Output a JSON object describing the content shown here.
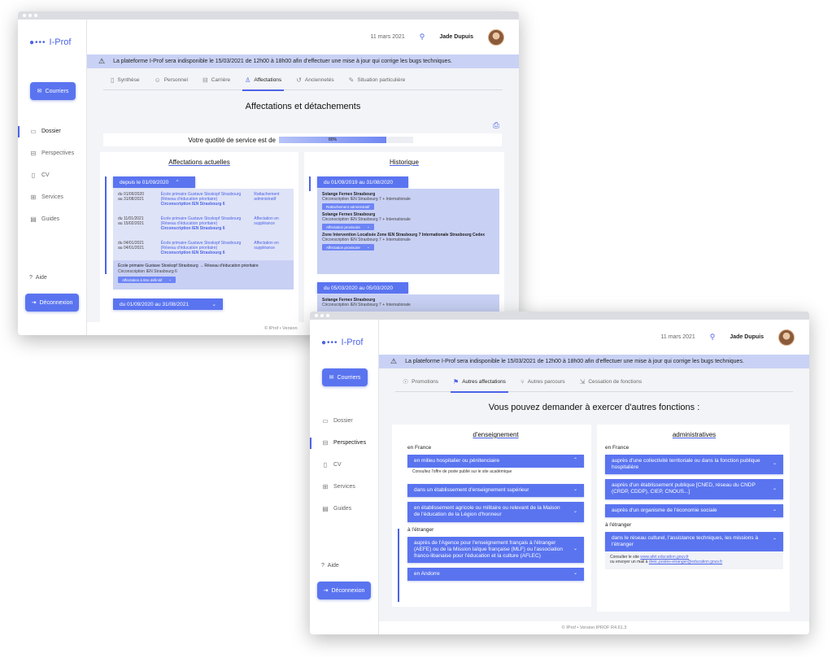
{
  "app": {
    "logo_text": "I-Prof",
    "courriers_label": "Courriers",
    "aide_label": "Aide",
    "logout_label": "Déconnexion",
    "date": "11 mars 2021",
    "user_name": "Jade Dupuis",
    "alert_text": "La plateforme I-Prof sera indisponible le 15/03/2021 de 12h00 à 18h00 afin d'effectuer une mise à jour qui corrige les bugs techniques.",
    "footer_text": "© IProf • Version IPROF R4.61.3",
    "footer_text_short": "© IProf • Version",
    "sidebar": [
      {
        "label": "Dossier",
        "icon": "folder-icon"
      },
      {
        "label": "Perspectives",
        "icon": "briefcase-icon"
      },
      {
        "label": "CV",
        "icon": "clipboard-icon"
      },
      {
        "label": "Services",
        "icon": "grid-icon"
      },
      {
        "label": "Guides",
        "icon": "book-icon"
      }
    ],
    "accent_color": "#5a74f0"
  },
  "win1": {
    "tabs": [
      {
        "label": "Synthèse",
        "icon": "clipboard-icon"
      },
      {
        "label": "Personnel",
        "icon": "user-icon"
      },
      {
        "label": "Carrière",
        "icon": "archive-icon"
      },
      {
        "label": "Affectations",
        "icon": "person-pin-icon"
      },
      {
        "label": "Anciennetés",
        "icon": "history-icon"
      },
      {
        "label": "Situation particulière",
        "icon": "pencil-icon"
      }
    ],
    "title": "Affectations et détachements",
    "quotite_label": "Votre quotité de service est de",
    "quotite_value": "80%",
    "quotite_fraction": 0.8,
    "actuelles": {
      "title": "Affectations actuelles",
      "group1": "depuis le 01/09/2020",
      "rows": [
        {
          "dates": "du 01/09/2020\nau 31/08/2021",
          "school": "École primaire Gustave Stoskopf Strasbourg (Réseau d'éducation prioritaire)",
          "circ": "Circonscription IEN Strasbourg 6",
          "type": "Rattachement administratif"
        },
        {
          "dates": "du 11/01/2021\nau 15/02/2021",
          "school": "École primaire Gustave Stoskopf Strasbourg (Réseau d'éducation prioritaire)",
          "circ": "Circonscription IEN Strasbourg 6",
          "type": "Affectation en suppléance"
        },
        {
          "dates": "du 04/01/2021\nau 04/01/2021",
          "school": "École primaire Gustave Stoskopf Strasbourg (Réseau d'éducation prioritaire)",
          "circ": "Circonscription IEN Strasbourg 6",
          "type": "Affectation en suppléance"
        }
      ],
      "detail_line1": "École primaire Gustave Stoskopf Strasbourg → Réseau d'éducation prioritaire",
      "detail_line2": "Circonscription IEN Strasbourg 6",
      "detail_pill": "Affectation à titre définitif",
      "group2": "du 01/09/2020 au 31/08/2021"
    },
    "historique": {
      "title": "Historique",
      "group1": "du 01/09/2019 au 31/08/2020",
      "entries": [
        {
          "name": "Solange Fernex Strasbourg",
          "circ": "Circonscription IEN Strasbourg 7 + Internationale",
          "pill": "Rattachement administratif"
        },
        {
          "name": "Solange Fernex Strasbourg",
          "circ": "Circonscription IEN Strasbourg 7 + Internationale",
          "pill": "Affectation provisoire"
        },
        {
          "name": "Zone Intervention Localisée Zone IEN Strasbourg 7 Internationale Strasbourg Cedex",
          "circ": "Circonscription IEN Strasbourg 7 + Internationale",
          "pill": "Affectation provisoire"
        }
      ],
      "group2": "du 05/03/2020 au 05/03/2020",
      "entry2_name": "Solange Fernex Strasbourg",
      "entry2_circ": "Circonscription IEN Strasbourg 7 + Internationale"
    }
  },
  "win2": {
    "tabs": [
      {
        "label": "Promotions",
        "icon": "medal-icon"
      },
      {
        "label": "Autres affectations",
        "icon": "signpost-icon"
      },
      {
        "label": "Autres parcours",
        "icon": "branch-icon"
      },
      {
        "label": "Cessation de fonctions",
        "icon": "exit-icon"
      }
    ],
    "title": "Vous pouvez demander à exercer d'autres fonctions :",
    "enseignement": {
      "title": "d'enseignement",
      "en_france": "en France",
      "options": [
        "en milieu hospitalier ou pénitenciaire",
        "dans un établissement d'enseignement supérieur",
        "en établissement agricole ou militaire ou relevant de la Maison de l'éducation de la Légion d'honneur"
      ],
      "note": "Consultez l'offre de poste publié sur le site académique",
      "a_letranger": "à l'étranger",
      "options_etranger": [
        "auprès de l'Agence pour l'enseignement français à l'étranger (AEFE) ou de la Mission laïque française (MLF) ou l'association franco-libanaise pour l'éducation et la culture (AFLEC)",
        "en Andorre"
      ]
    },
    "administratives": {
      "title": "administratives",
      "en_france": "en France",
      "options": [
        "auprès d'une collectivité territoriale ou dans la fonction publique hospitalière",
        "auprès d'un établissement publique [CNED, réseau du CNDP (CRDP, CDDP), CIEP, CNOUS...]",
        "auprès d'un organisme de l'économie sociale"
      ],
      "a_letranger": "à l'étranger",
      "option_etranger": "dans le réseau culturel, l'assistance techniques, les missions à l'étranger",
      "note_line1_prefix": "Consulter le site",
      "note_line1_link": "www.afet.education.gouv.fr",
      "note_line2_prefix": "ou envoyer un mail à",
      "note_line2_link": "dreic.postes-etranger@education.gouv.fr"
    }
  }
}
